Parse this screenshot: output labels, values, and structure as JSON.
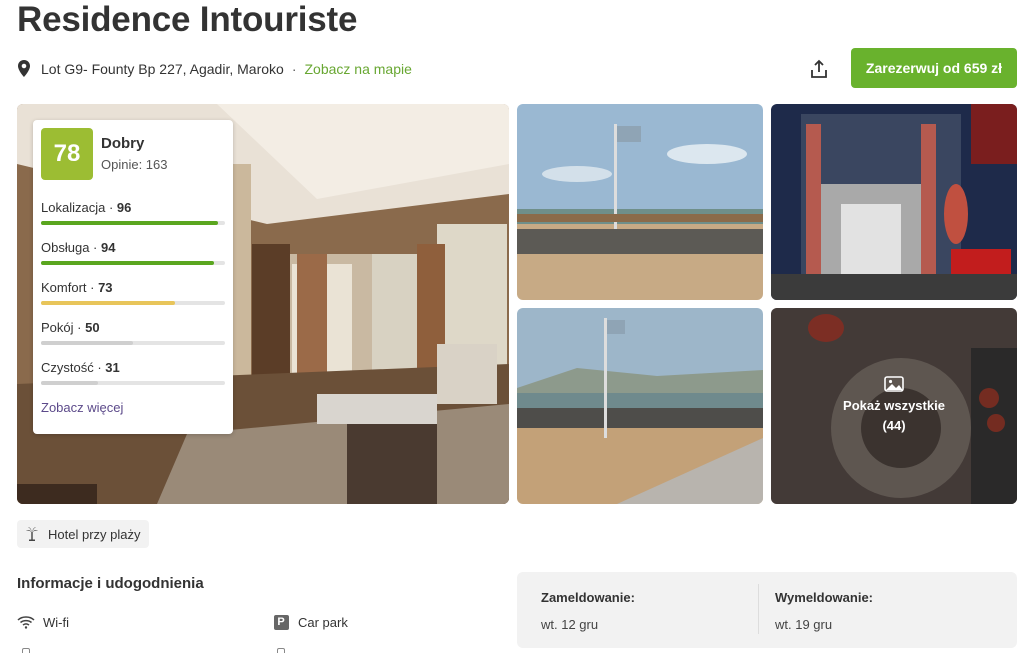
{
  "hotel": {
    "name": "Residence Intouriste",
    "address": "Lot G9- Founty Bp 227, Agadir, Maroko",
    "separator": "·",
    "map_link": "Zobacz na mapie"
  },
  "actions": {
    "share_icon": "share-icon",
    "book_label": "Zarezerwuj od 659 zł",
    "brand_color": "#69b22d"
  },
  "rating": {
    "score": "78",
    "word": "Dobry",
    "reviews": "Opinie: 163",
    "score_color": "#9cbd33",
    "categories": [
      {
        "label": "Lokalizacja",
        "value": "96",
        "level": 0.96,
        "color": "#5aa61f"
      },
      {
        "label": "Obsługa",
        "value": "94",
        "level": 0.94,
        "color": "#5aa61f"
      },
      {
        "label": "Komfort",
        "value": "73",
        "level": 0.73,
        "color": "#e8c55a"
      },
      {
        "label": "Pokój",
        "value": "50",
        "level": 0.5,
        "color": "#cfcfcf"
      },
      {
        "label": "Czystość",
        "value": "31",
        "level": 0.31,
        "color": "#cfcfcf"
      }
    ],
    "more_link": "Zobacz więcej"
  },
  "gallery": {
    "show_all_label": "Pokaż wszystkie",
    "show_all_count": "(44)"
  },
  "tags": [
    {
      "label": "Hotel przy plaży",
      "icon": "palm-tree-icon"
    }
  ],
  "info": {
    "section_title": "Informacje i udogodnienia",
    "amenities": [
      {
        "label": "Wi-fi",
        "icon": "wifi-icon"
      },
      {
        "label": "Car park",
        "icon": "parking-icon",
        "icon_text": "P"
      }
    ]
  },
  "stay": {
    "checkin_label": "Zameldowanie:",
    "checkin_value": "wt. 12 gru",
    "checkout_label": "Wymeldowanie:",
    "checkout_value": "wt. 19 gru"
  }
}
